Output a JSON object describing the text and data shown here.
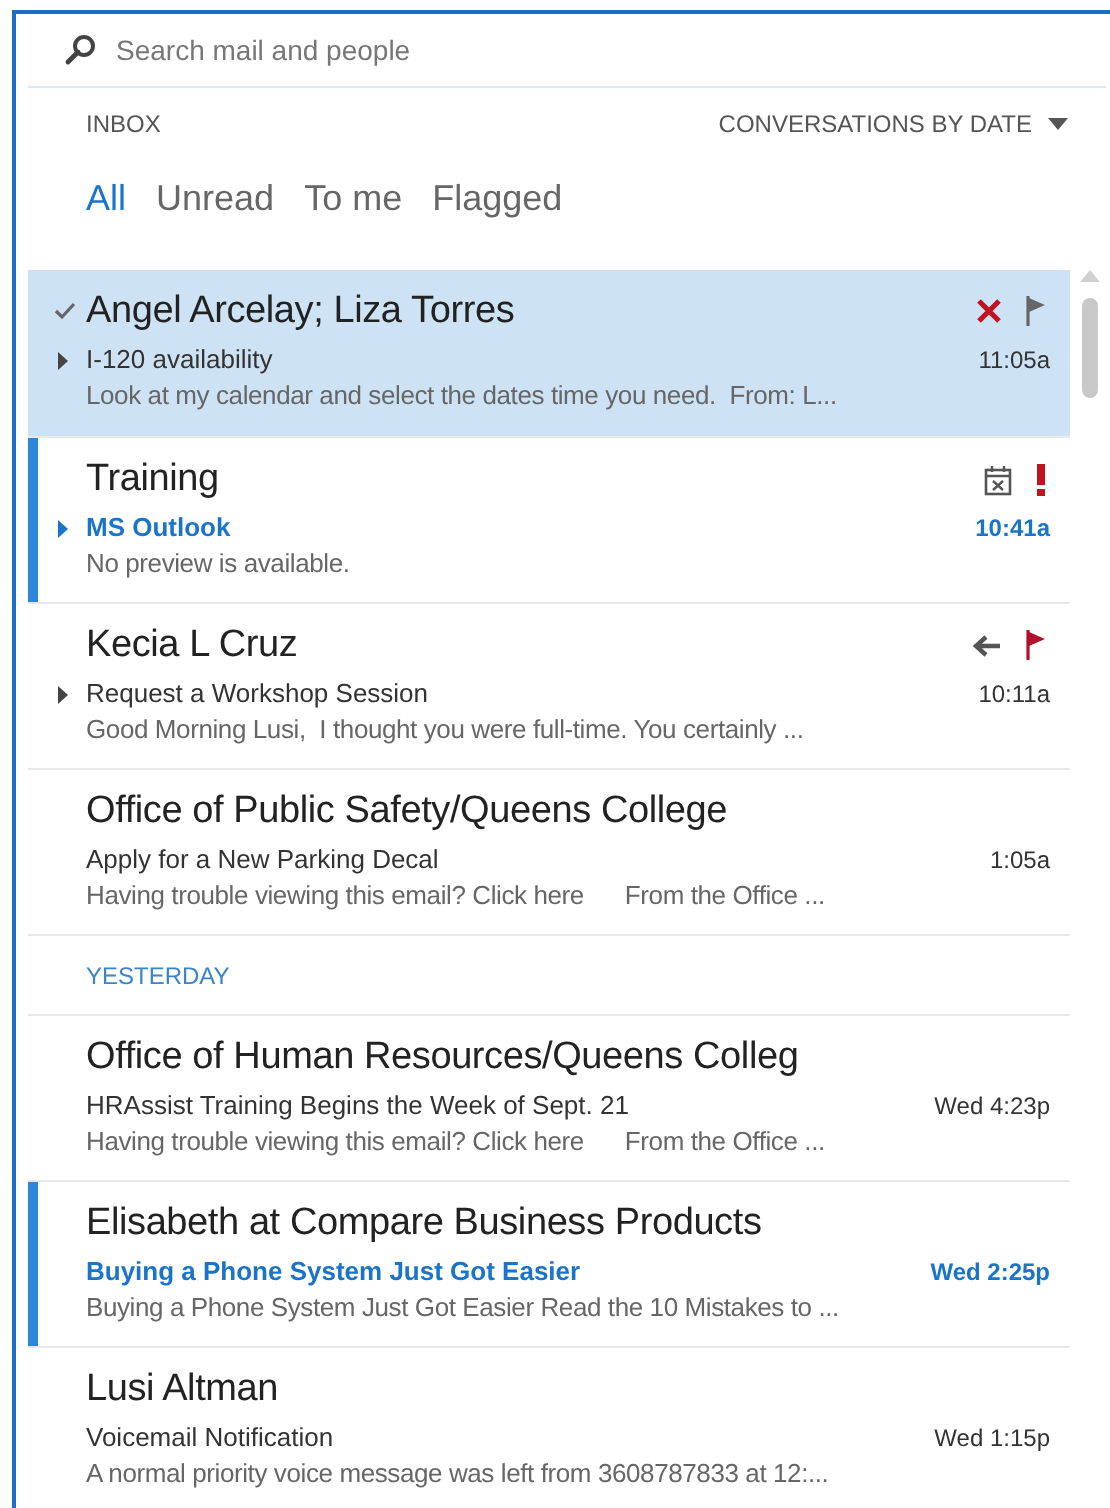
{
  "search": {
    "placeholder": "Search mail and people"
  },
  "folder": "INBOX",
  "sort": "CONVERSATIONS BY DATE",
  "filters": [
    {
      "label": "All",
      "selected": true
    },
    {
      "label": "Unread",
      "selected": false
    },
    {
      "label": "To me",
      "selected": false
    },
    {
      "label": "Flagged",
      "selected": false
    }
  ],
  "messages": [
    {
      "kind": "message",
      "sender": "Angel Arcelay; Liza Torres",
      "subject": "I-120 availability",
      "preview": "Look at my calendar and select the dates time you need.  From: L...",
      "time": "11:05a",
      "selected": true,
      "unread": false,
      "checked": true,
      "thread": true,
      "icons": [
        {
          "kind": "delete"
        },
        {
          "kind": "flag",
          "flagged": false
        }
      ]
    },
    {
      "kind": "message",
      "sender": "Training",
      "subject": "MS Outlook",
      "preview": "No preview is available.",
      "time": "10:41a",
      "selected": false,
      "unread": true,
      "checked": false,
      "thread": true,
      "icons": [
        {
          "kind": "calendar"
        },
        {
          "kind": "important"
        }
      ]
    },
    {
      "kind": "message",
      "sender": "Kecia L Cruz",
      "subject": "Request a Workshop Session",
      "preview": "Good Morning Lusi,  I thought you were full-time. You certainly ...",
      "time": "10:11a",
      "selected": false,
      "unread": false,
      "checked": false,
      "thread": true,
      "icons": [
        {
          "kind": "reply"
        },
        {
          "kind": "flag",
          "flagged": true
        }
      ]
    },
    {
      "kind": "message",
      "sender": "Office of Public Safety/Queens College",
      "subject": "Apply for a New Parking Decal",
      "preview": "Having trouble viewing this email? Click here      From the Office ...",
      "time": "1:05a",
      "selected": false,
      "unread": false,
      "checked": false,
      "thread": false
    },
    {
      "kind": "header",
      "label": "YESTERDAY"
    },
    {
      "kind": "message",
      "sender": "Office of Human Resources/Queens Colleg",
      "subject": "HRAssist Training Begins the Week of Sept. 21",
      "preview": "Having trouble viewing this email? Click here      From the Office ...",
      "time": "Wed 4:23p",
      "selected": false,
      "unread": false,
      "checked": false,
      "thread": false
    },
    {
      "kind": "message",
      "sender": "Elisabeth at Compare Business Products",
      "subject": "Buying a Phone System Just Got Easier",
      "preview": "Buying a Phone System Just Got Easier Read the 10 Mistakes to ...",
      "time": "Wed 2:25p",
      "selected": false,
      "unread": true,
      "checked": false,
      "thread": false
    },
    {
      "kind": "message",
      "sender": "Lusi Altman",
      "subject": "Voicemail Notification",
      "preview": "A normal priority voice message was left from 3608787833 at 12:...",
      "time": "Wed 1:15p",
      "selected": false,
      "unread": false,
      "checked": false,
      "thread": false
    }
  ]
}
